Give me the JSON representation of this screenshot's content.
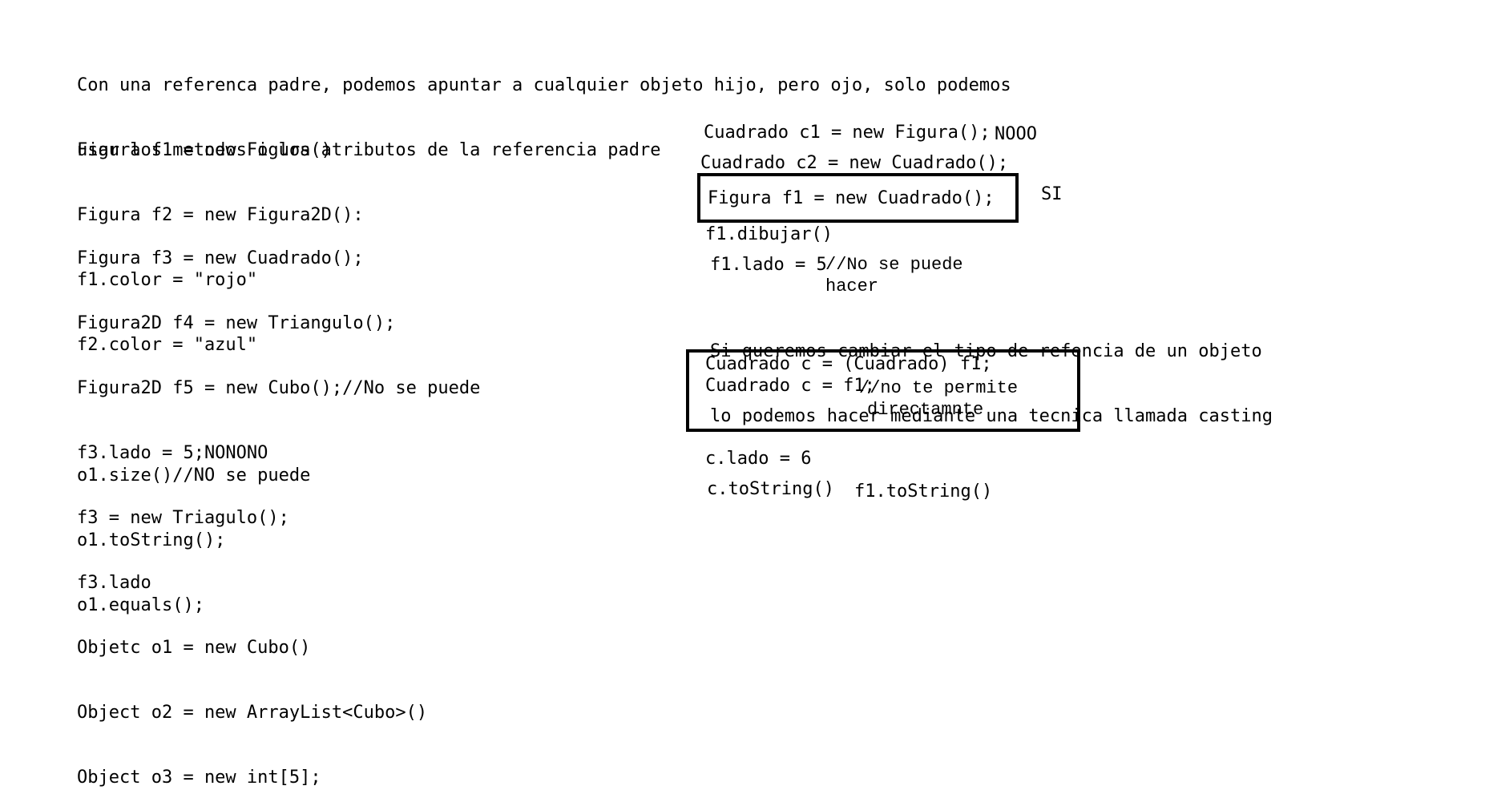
{
  "intro": [
    "Con una referenca padre, podemos apuntar a cualquier objeto hijo, pero ojo, solo podemos",
    "usar los metodos o los atributos de la referencia padre"
  ],
  "left_block_1": [
    "Figura f1 = new Figura()",
    "Figura f2 = new Figura2D():",
    "f1.color = \"rojo\"",
    "f2.color = \"azul\""
  ],
  "left_block_2": [
    "Figura f3 = new Cuadrado();",
    "Figura2D f4 = new Triangulo();",
    "Figura2D f5 = new Cubo();//No se puede",
    "f3.lado = 5;NONONO",
    "f3 = new Triagulo();",
    "f3.lado",
    "Objetc o1 = new Cubo()",
    "Object o2 = new ArrayList<Cubo>()",
    "Object o3 = new int[5];"
  ],
  "left_block_3": [
    "o1.size()//NO se puede",
    "o1.toString();",
    "o1.equals();"
  ],
  "right": {
    "line_c1": "Cuadrado c1 = new Figura();",
    "nooo": "NOOO",
    "line_c2": "Cuadrado c2 = new Cuadrado();",
    "boxed_f1": "Figura f1 = new Cuadrado();",
    "si": "SI",
    "dibujar": "f1.dibujar()",
    "lado_code": "f1.lado = 5",
    "lado_comment_1": "//No se puede",
    "lado_comment_2": "hacer",
    "casting_text": [
      "Si queremos cambiar el tipo de refencia de un objeto",
      "lo podemos hacer mediante una tecnica llamada casting"
    ],
    "cast_line_1": "Cuadrado c = (Cuadrado) f1;",
    "cast_line_2": "Cuadrado c = f1;",
    "cast_comment_1": "//no te permite",
    "cast_comment_2": "directamnte",
    "c_lado": "c.lado = 6",
    "c_tostring": "c.toString()",
    "f1_tostring": "f1.toString()"
  }
}
